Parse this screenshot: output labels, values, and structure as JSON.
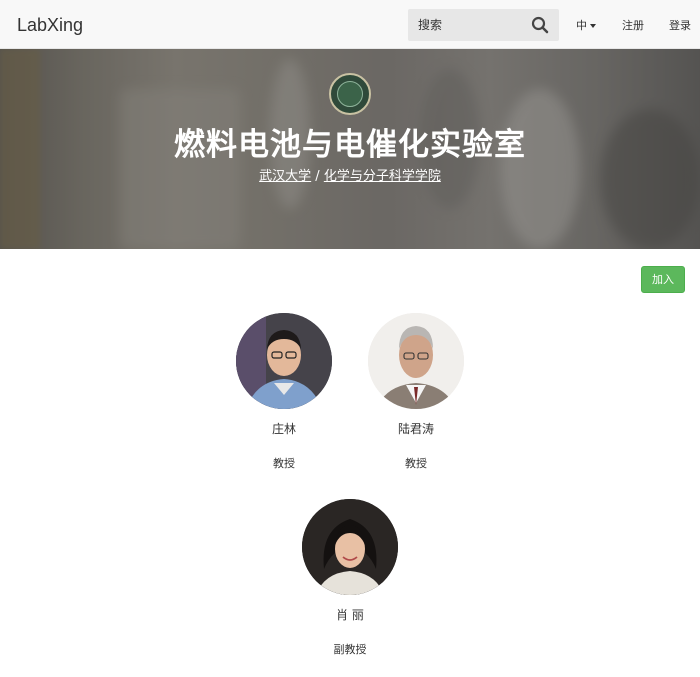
{
  "navbar": {
    "brand": "LabXing",
    "search_placeholder": "搜索",
    "language": "中",
    "register": "注册",
    "login": "登录"
  },
  "hero": {
    "title": "燃料电池与电催化实验室",
    "university": "武汉大学",
    "separator": " / ",
    "school": "化学与分子科学学院"
  },
  "join_button": "加入",
  "members": [
    {
      "name": "庄林",
      "title": "教授"
    },
    {
      "name": "陆君涛",
      "title": "教授"
    },
    {
      "name": "肖 丽",
      "title": "副教授"
    }
  ],
  "colors": {
    "join_green": "#5cb85c",
    "navbar_bg": "#f8f8f8"
  }
}
